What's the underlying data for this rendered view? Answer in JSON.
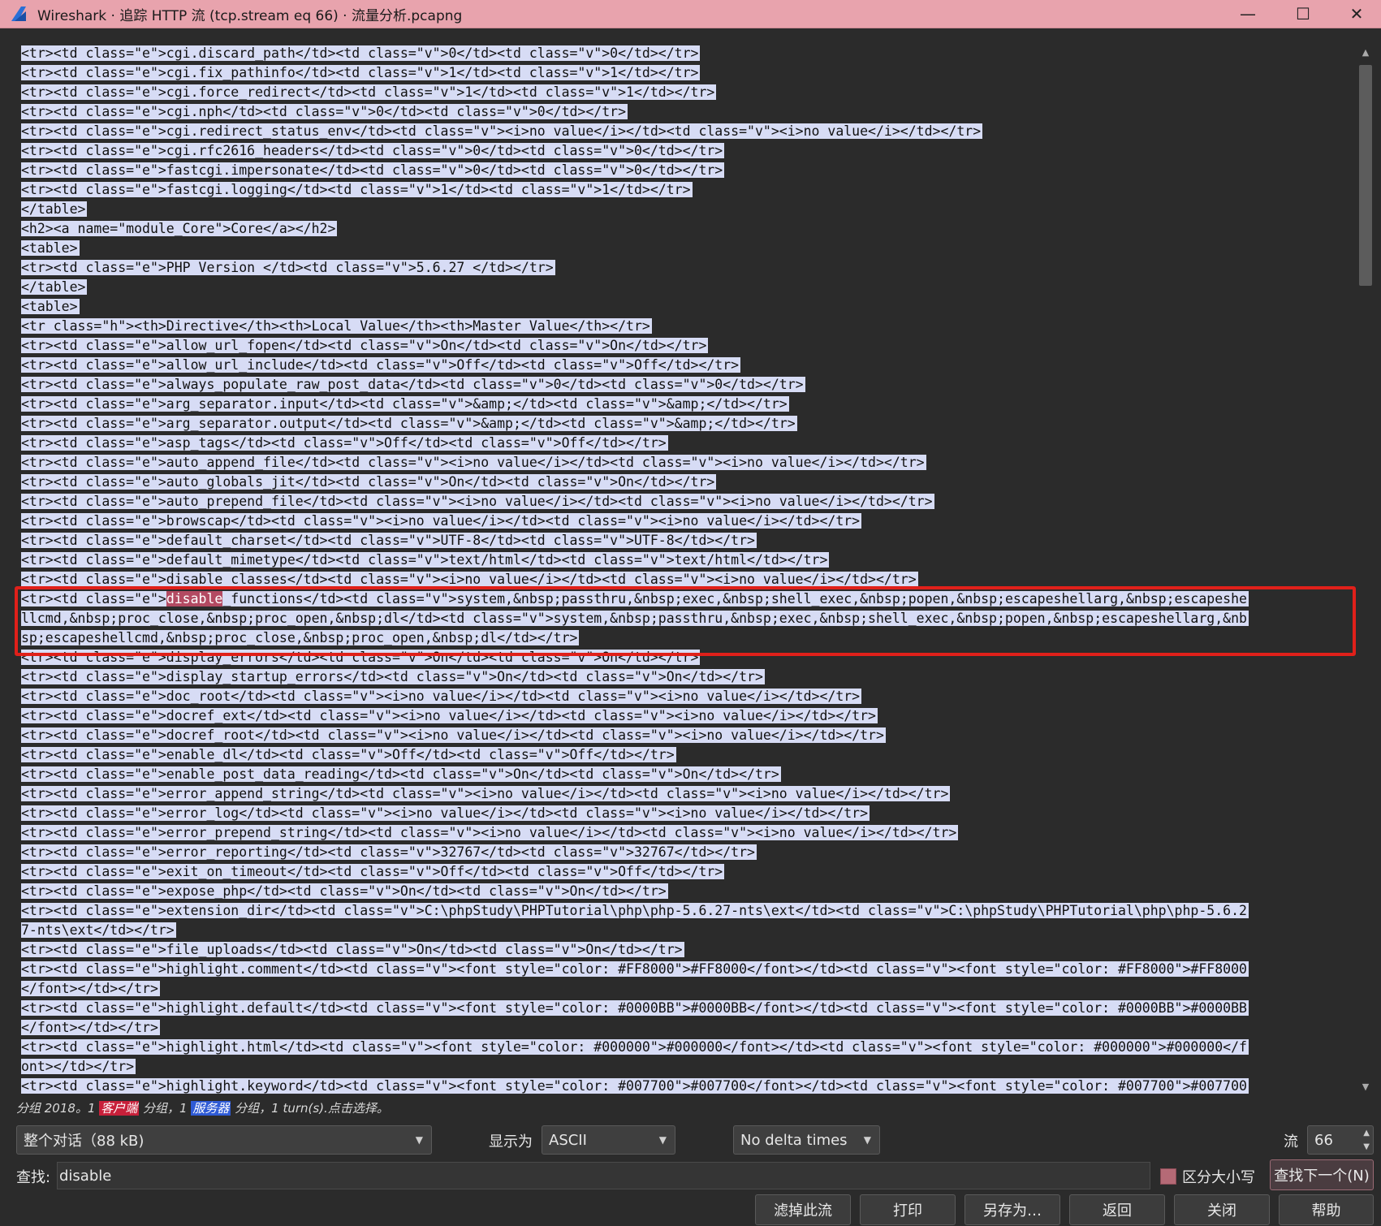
{
  "window": {
    "title": "Wireshark · 追踪 HTTP 流 (tcp.stream eq 66) · 流量分析.pcapng",
    "controls": [
      "—",
      "☐",
      "✕"
    ]
  },
  "stream_lines": [
    "<tr><td class=\"e\">cgi.discard_path</td><td class=\"v\">0</td><td class=\"v\">0</td></tr>",
    "<tr><td class=\"e\">cgi.fix_pathinfo</td><td class=\"v\">1</td><td class=\"v\">1</td></tr>",
    "<tr><td class=\"e\">cgi.force_redirect</td><td class=\"v\">1</td><td class=\"v\">1</td></tr>",
    "<tr><td class=\"e\">cgi.nph</td><td class=\"v\">0</td><td class=\"v\">0</td></tr>",
    "<tr><td class=\"e\">cgi.redirect_status_env</td><td class=\"v\"><i>no value</i></td><td class=\"v\"><i>no value</i></td></tr>",
    "<tr><td class=\"e\">cgi.rfc2616_headers</td><td class=\"v\">0</td><td class=\"v\">0</td></tr>",
    "<tr><td class=\"e\">fastcgi.impersonate</td><td class=\"v\">0</td><td class=\"v\">0</td></tr>",
    "<tr><td class=\"e\">fastcgi.logging</td><td class=\"v\">1</td><td class=\"v\">1</td></tr>",
    "</table>",
    "<h2><a name=\"module_Core\">Core</a></h2>",
    "<table>",
    "<tr><td class=\"e\">PHP Version </td><td class=\"v\">5.6.27 </td></tr>",
    "</table>",
    "<table>",
    "<tr class=\"h\"><th>Directive</th><th>Local Value</th><th>Master Value</th></tr>",
    "<tr><td class=\"e\">allow_url_fopen</td><td class=\"v\">On</td><td class=\"v\">On</td></tr>",
    "<tr><td class=\"e\">allow_url_include</td><td class=\"v\">Off</td><td class=\"v\">Off</td></tr>",
    "<tr><td class=\"e\">always_populate_raw_post_data</td><td class=\"v\">0</td><td class=\"v\">0</td></tr>",
    "<tr><td class=\"e\">arg_separator.input</td><td class=\"v\">&amp;</td><td class=\"v\">&amp;</td></tr>",
    "<tr><td class=\"e\">arg_separator.output</td><td class=\"v\">&amp;</td><td class=\"v\">&amp;</td></tr>",
    "<tr><td class=\"e\">asp_tags</td><td class=\"v\">Off</td><td class=\"v\">Off</td></tr>",
    "<tr><td class=\"e\">auto_append_file</td><td class=\"v\"><i>no value</i></td><td class=\"v\"><i>no value</i></td></tr>",
    "<tr><td class=\"e\">auto_globals_jit</td><td class=\"v\">On</td><td class=\"v\">On</td></tr>",
    "<tr><td class=\"e\">auto_prepend_file</td><td class=\"v\"><i>no value</i></td><td class=\"v\"><i>no value</i></td></tr>",
    "<tr><td class=\"e\">browscap</td><td class=\"v\"><i>no value</i></td><td class=\"v\"><i>no value</i></td></tr>",
    "<tr><td class=\"e\">default_charset</td><td class=\"v\">UTF-8</td><td class=\"v\">UTF-8</td></tr>",
    "<tr><td class=\"e\">default_mimetype</td><td class=\"v\">text/html</td><td class=\"v\">text/html</td></tr>",
    "<tr><td class=\"e\">disable_classes</td><td class=\"v\"><i>no value</i></td><td class=\"v\"><i>no value</i></td></tr>",
    "<tr><td class=\"e\">disable_functions</td><td class=\"v\">system,&nbsp;passthru,&nbsp;exec,&nbsp;shell_exec,&nbsp;popen,&nbsp;escapeshellarg,&nbsp;escapeshe",
    "llcmd,&nbsp;proc_close,&nbsp;proc_open,&nbsp;dl</td><td class=\"v\">system,&nbsp;passthru,&nbsp;exec,&nbsp;shell_exec,&nbsp;popen,&nbsp;escapeshellarg,&nb",
    "sp;escapeshellcmd,&nbsp;proc_close,&nbsp;proc_open,&nbsp;dl</td></tr>",
    "<tr><td class=\"e\">display_errors</td><td class=\"v\">On</td><td class=\"v\">On</td></tr>",
    "<tr><td class=\"e\">display_startup_errors</td><td class=\"v\">On</td><td class=\"v\">On</td></tr>",
    "<tr><td class=\"e\">doc_root</td><td class=\"v\"><i>no value</i></td><td class=\"v\"><i>no value</i></td></tr>",
    "<tr><td class=\"e\">docref_ext</td><td class=\"v\"><i>no value</i></td><td class=\"v\"><i>no value</i></td></tr>",
    "<tr><td class=\"e\">docref_root</td><td class=\"v\"><i>no value</i></td><td class=\"v\"><i>no value</i></td></tr>",
    "<tr><td class=\"e\">enable_dl</td><td class=\"v\">Off</td><td class=\"v\">Off</td></tr>",
    "<tr><td class=\"e\">enable_post_data_reading</td><td class=\"v\">On</td><td class=\"v\">On</td></tr>",
    "<tr><td class=\"e\">error_append_string</td><td class=\"v\"><i>no value</i></td><td class=\"v\"><i>no value</i></td></tr>",
    "<tr><td class=\"e\">error_log</td><td class=\"v\"><i>no value</i></td><td class=\"v\"><i>no value</i></td></tr>",
    "<tr><td class=\"e\">error_prepend_string</td><td class=\"v\"><i>no value</i></td><td class=\"v\"><i>no value</i></td></tr>",
    "<tr><td class=\"e\">error_reporting</td><td class=\"v\">32767</td><td class=\"v\">32767</td></tr>",
    "<tr><td class=\"e\">exit_on_timeout</td><td class=\"v\">Off</td><td class=\"v\">Off</td></tr>",
    "<tr><td class=\"e\">expose_php</td><td class=\"v\">On</td><td class=\"v\">On</td></tr>",
    "<tr><td class=\"e\">extension_dir</td><td class=\"v\">C:\\phpStudy\\PHPTutorial\\php\\php-5.6.27-nts\\ext</td><td class=\"v\">C:\\phpStudy\\PHPTutorial\\php\\php-5.6.2",
    "7-nts\\ext</td></tr>",
    "<tr><td class=\"e\">file_uploads</td><td class=\"v\">On</td><td class=\"v\">On</td></tr>",
    "<tr><td class=\"e\">highlight.comment</td><td class=\"v\"><font style=\"color: #FF8000\">#FF8000</font></td><td class=\"v\"><font style=\"color: #FF8000\">#FF8000",
    "</font></td></tr>",
    "<tr><td class=\"e\">highlight.default</td><td class=\"v\"><font style=\"color: #0000BB\">#0000BB</font></td><td class=\"v\"><font style=\"color: #0000BB\">#0000BB",
    "</font></td></tr>",
    "<tr><td class=\"e\">highlight.html</td><td class=\"v\"><font style=\"color: #000000\">#000000</font></td><td class=\"v\"><font style=\"color: #000000\">#000000</f",
    "ont></td></tr>",
    "<tr><td class=\"e\">highlight.keyword</td><td class=\"v\"><font style=\"color: #007700\">#007700</font></td><td class=\"v\"><font style=\"color: #007700\">#007700"
  ],
  "search_hit": {
    "line": 28,
    "term": "disable"
  },
  "status": {
    "prefix": "分组 2018。1 ",
    "client": "客户端",
    "mid": " 分组，1 ",
    "server": "服务器",
    "suffix": " 分组，1 turn(s).点击选择。"
  },
  "controls": {
    "conversation": "整个对话（88 kB)",
    "show_as_label": "显示为",
    "show_as_value": "ASCII",
    "delta": "No delta times",
    "stream_label": "流",
    "stream_value": "66",
    "find_label": "查找:",
    "find_value": "disable",
    "case_label": "区分大小写",
    "find_next": "查找下一个(N)"
  },
  "buttons": {
    "filter_out": "滤掉此流",
    "print": "打印",
    "save_as": "另存为…",
    "back": "返回",
    "close": "关闭",
    "help": "帮助"
  },
  "colors": {
    "titlebar": "#e8a3ad",
    "selection": "#d7dcf5",
    "highlight_box": "#e0201a",
    "search_hit": "#b34a62"
  }
}
